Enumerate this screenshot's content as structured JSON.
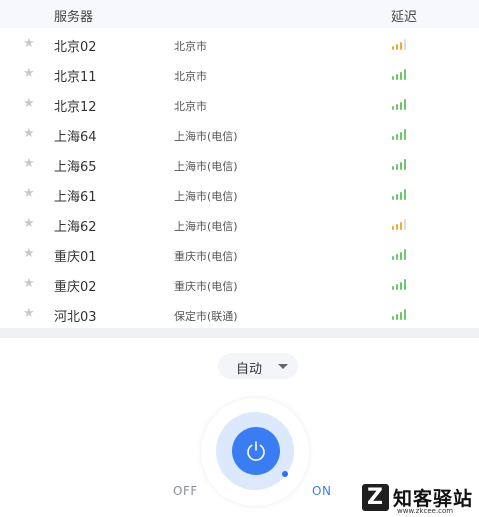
{
  "header": {
    "server_label": "服务器",
    "latency_label": "延迟"
  },
  "servers": [
    {
      "name": "北京02",
      "location": "北京市",
      "signal": "warn",
      "latency_bars": 3
    },
    {
      "name": "北京11",
      "location": "北京市",
      "signal": "good",
      "latency_bars": 4
    },
    {
      "name": "北京12",
      "location": "北京市",
      "signal": "good",
      "latency_bars": 4
    },
    {
      "name": "上海64",
      "location": "上海市(电信)",
      "signal": "good",
      "latency_bars": 4
    },
    {
      "name": "上海65",
      "location": "上海市(电信)",
      "signal": "good",
      "latency_bars": 4
    },
    {
      "name": "上海61",
      "location": "上海市(电信)",
      "signal": "good",
      "latency_bars": 4
    },
    {
      "name": "上海62",
      "location": "上海市(电信)",
      "signal": "warn",
      "latency_bars": 3
    },
    {
      "name": "重庆01",
      "location": "重庆市(电信)",
      "signal": "good",
      "latency_bars": 4
    },
    {
      "name": "重庆02",
      "location": "重庆市(电信)",
      "signal": "good",
      "latency_bars": 4
    },
    {
      "name": "河北03",
      "location": "保定市(联通)",
      "signal": "good",
      "latency_bars": 4
    }
  ],
  "mode": {
    "selected": "自动"
  },
  "power": {
    "off_label": "OFF",
    "on_label": "ON",
    "state": "on"
  },
  "watermark": {
    "logo_letter": "Z",
    "name": "知客驿站",
    "url": "www.zkcee.com"
  },
  "colors": {
    "accent": "#3a7df3",
    "signal_good": "#6cc66a",
    "signal_warn": "#f2a935",
    "star": "#c9c9c9"
  },
  "icons": {
    "favorite": "star-icon",
    "power": "power-icon",
    "dropdown": "chevron-down-icon",
    "latency": "signal-bars-icon"
  }
}
